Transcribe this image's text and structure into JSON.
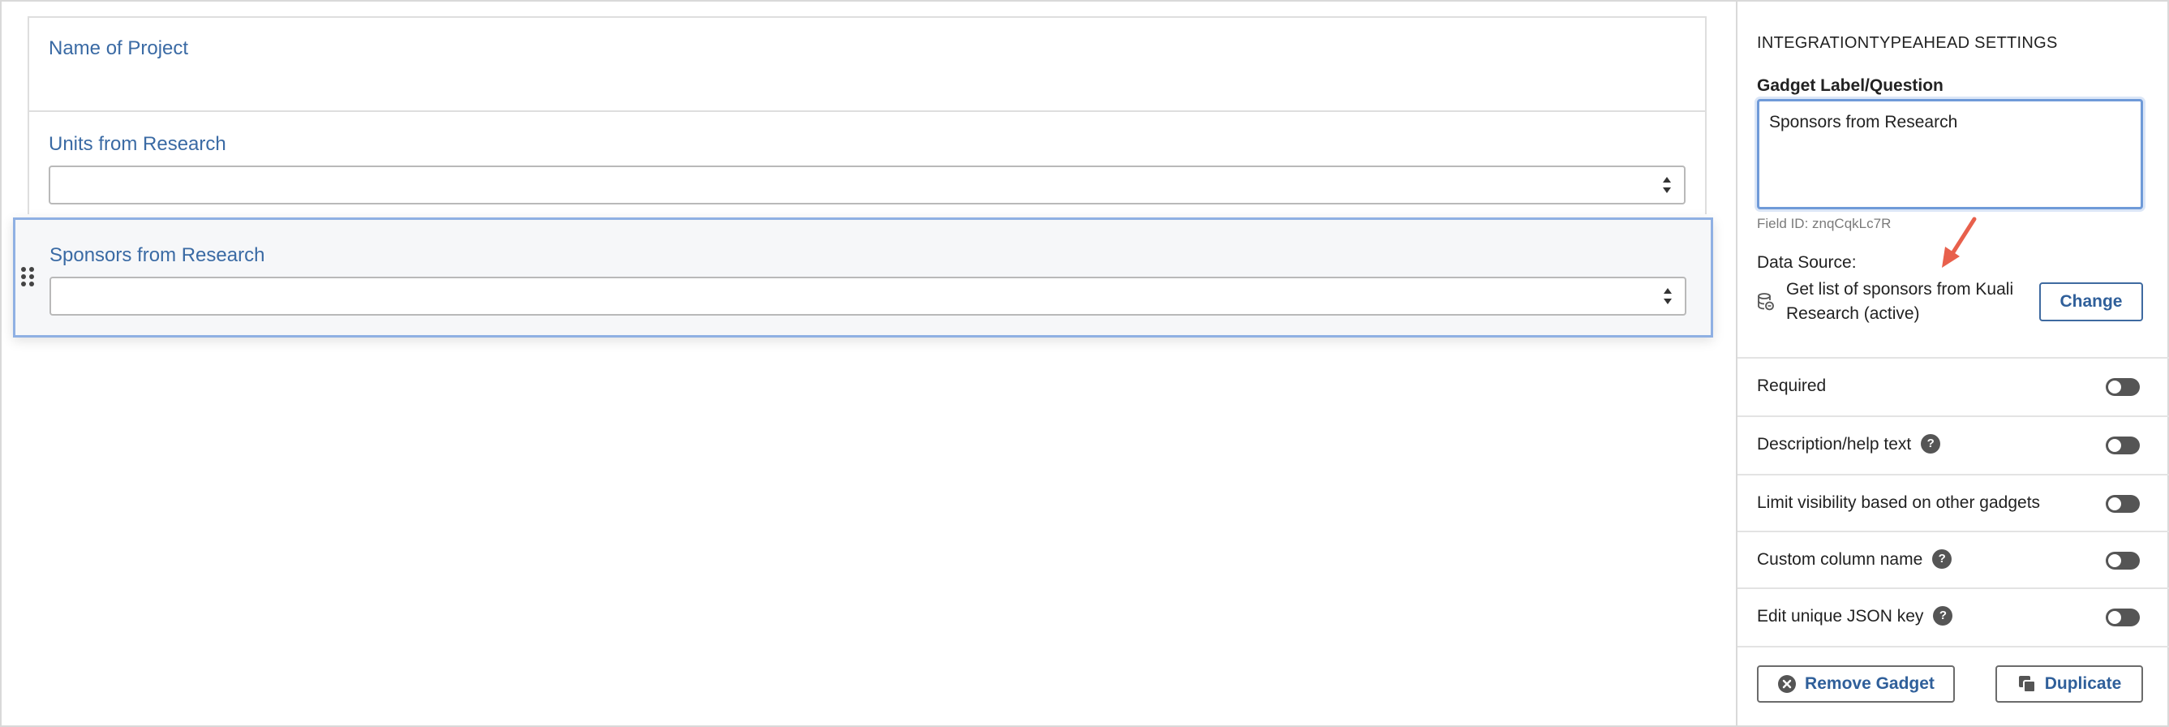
{
  "form": {
    "fields": [
      {
        "label": "Name of Project"
      },
      {
        "label": "Units from Research"
      },
      {
        "label": "Sponsors from Research"
      }
    ]
  },
  "sidebar": {
    "title": "INTEGRATIONTYPEAHEAD SETTINGS",
    "gadget_label_title": "Gadget Label/Question",
    "gadget_label_value": "Sponsors from Research",
    "field_id": "Field ID: znqCqkLc7R",
    "data_source_label": "Data Source:",
    "data_source_value": "Get list of sponsors from Kuali Research (active)",
    "change_label": "Change",
    "toggles": [
      {
        "label": "Required",
        "help": false,
        "on": false
      },
      {
        "label": "Description/help text",
        "help": true,
        "on": false
      },
      {
        "label": "Limit visibility based on other gadgets",
        "help": false,
        "on": false
      },
      {
        "label": "Custom column name",
        "help": true,
        "on": false
      },
      {
        "label": "Edit unique JSON key",
        "help": true,
        "on": false
      }
    ],
    "help_glyph": "?",
    "remove_label": "Remove Gadget",
    "duplicate_label": "Duplicate"
  },
  "colors": {
    "accent": "#3a6aa4",
    "selected_border": "#8fb0e3",
    "annotation_arrow": "#e8604c"
  },
  "icons": [
    "drag-handle-icon",
    "select-arrows-icon",
    "database-icon",
    "help-icon",
    "remove-circle-icon",
    "duplicate-icon",
    "annotation-arrow"
  ]
}
